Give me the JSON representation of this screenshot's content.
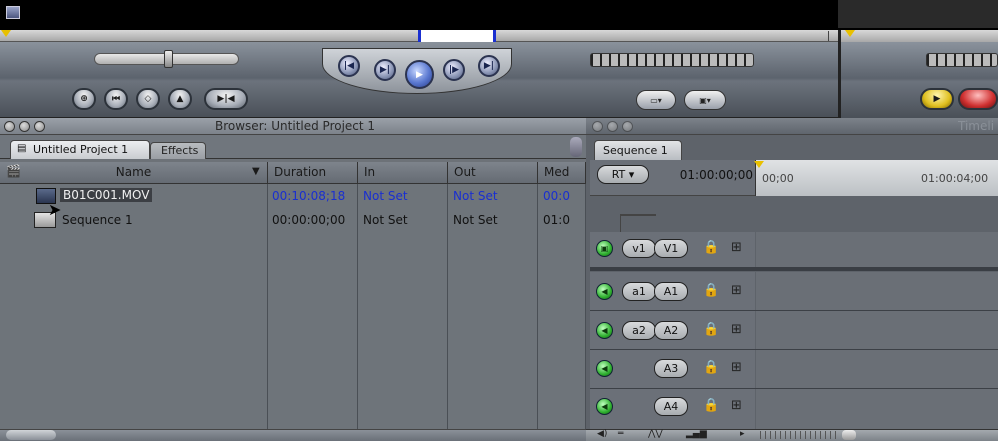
{
  "browser": {
    "window_title": "Browser: Untitled Project 1",
    "tabs": [
      "Untitled Project 1",
      "Effects"
    ],
    "columns": [
      "Name",
      "Duration",
      "In",
      "Out",
      "Med"
    ],
    "rows": [
      {
        "name": "B01C001.MOV",
        "duration": "00:10:08;18",
        "in": "Not Set",
        "out": "Not Set",
        "media": "00:0",
        "selected": true
      },
      {
        "name": "Sequence 1",
        "duration": "00:00:00;00",
        "in": "Not Set",
        "out": "Not Set",
        "media": "01:0",
        "selected": false
      }
    ]
  },
  "timeline": {
    "window_title": "Timeli",
    "tab": "Sequence 1",
    "rt_label": "RT",
    "timecode": "01:00:00;00",
    "ruler_labels": [
      "00;00",
      "01:00:04;00"
    ],
    "video_tracks": [
      {
        "source": "v1",
        "dest": "V1"
      }
    ],
    "audio_tracks": [
      {
        "source": "a1",
        "dest": "A1"
      },
      {
        "source": "a2",
        "dest": "A2"
      },
      {
        "source": "",
        "dest": "A3"
      },
      {
        "source": "",
        "dest": "A4"
      }
    ]
  },
  "viewer": {
    "transport_icons": [
      "previous-edit-icon",
      "play-in-to-out-icon",
      "play-icon",
      "play-around-icon",
      "next-edit-icon"
    ],
    "mark_icons": [
      "insert-edit-icon",
      "mark-in-icon",
      "add-marker-icon",
      "add-keyframe-icon",
      "match-frame-icon"
    ]
  },
  "colors": {
    "selection_text": "#1a2fd0",
    "duration_blue": "#1a2fd0",
    "green_toggle": "#2fb02f"
  }
}
